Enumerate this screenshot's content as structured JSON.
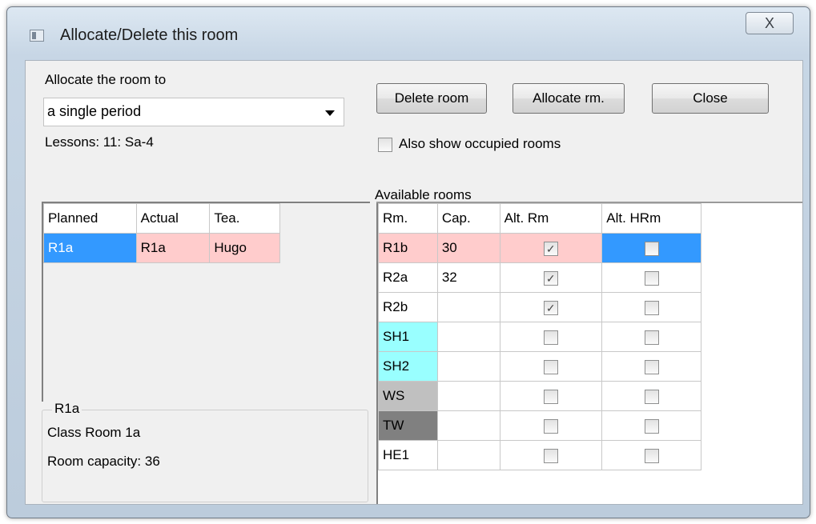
{
  "window": {
    "title": "Allocate/Delete this room",
    "close_glyph": "X"
  },
  "allocate": {
    "label": "Allocate the room to",
    "selected": "a single period",
    "lessons": "Lessons: 11: Sa-4"
  },
  "buttons": {
    "delete": "Delete room",
    "allocate": "Allocate rm.",
    "close": "Close"
  },
  "occupied_checkbox": {
    "label": "Also show occupied rooms",
    "checked": false
  },
  "available_label": "Available rooms",
  "lesson_table": {
    "headers": [
      "Planned",
      "Actual",
      "Tea."
    ],
    "rows": [
      {
        "planned": "R1a",
        "actual": "R1a",
        "teacher": "Hugo"
      }
    ]
  },
  "room_info": {
    "legend": "R1a",
    "name": "Class Room 1a",
    "capacity": "Room capacity: 36"
  },
  "rooms_table": {
    "headers": [
      "Rm.",
      "Cap.",
      "Alt. Rm",
      "Alt. HRm"
    ],
    "rows": [
      {
        "room": "R1b",
        "cap": "30",
        "alt_rm": true,
        "alt_hrm": false,
        "color": "#ffcccc"
      },
      {
        "room": "R2a",
        "cap": "32",
        "alt_rm": true,
        "alt_hrm": false,
        "color": "#ffffff"
      },
      {
        "room": "R2b",
        "cap": "",
        "alt_rm": true,
        "alt_hrm": false,
        "color": "#ffffff"
      },
      {
        "room": "SH1",
        "cap": "",
        "alt_rm": false,
        "alt_hrm": false,
        "color": "#99ffff"
      },
      {
        "room": "SH2",
        "cap": "",
        "alt_rm": false,
        "alt_hrm": false,
        "color": "#99ffff"
      },
      {
        "room": "WS",
        "cap": "",
        "alt_rm": false,
        "alt_hrm": false,
        "color": "#c0c0c0"
      },
      {
        "room": "TW",
        "cap": "",
        "alt_rm": false,
        "alt_hrm": false,
        "color": "#808080"
      },
      {
        "room": "HE1",
        "cap": "",
        "alt_rm": false,
        "alt_hrm": false,
        "color": "#ffffff"
      }
    ]
  },
  "colors": {
    "selection": "#3399ff",
    "highlight_row": "#ffcccc"
  }
}
